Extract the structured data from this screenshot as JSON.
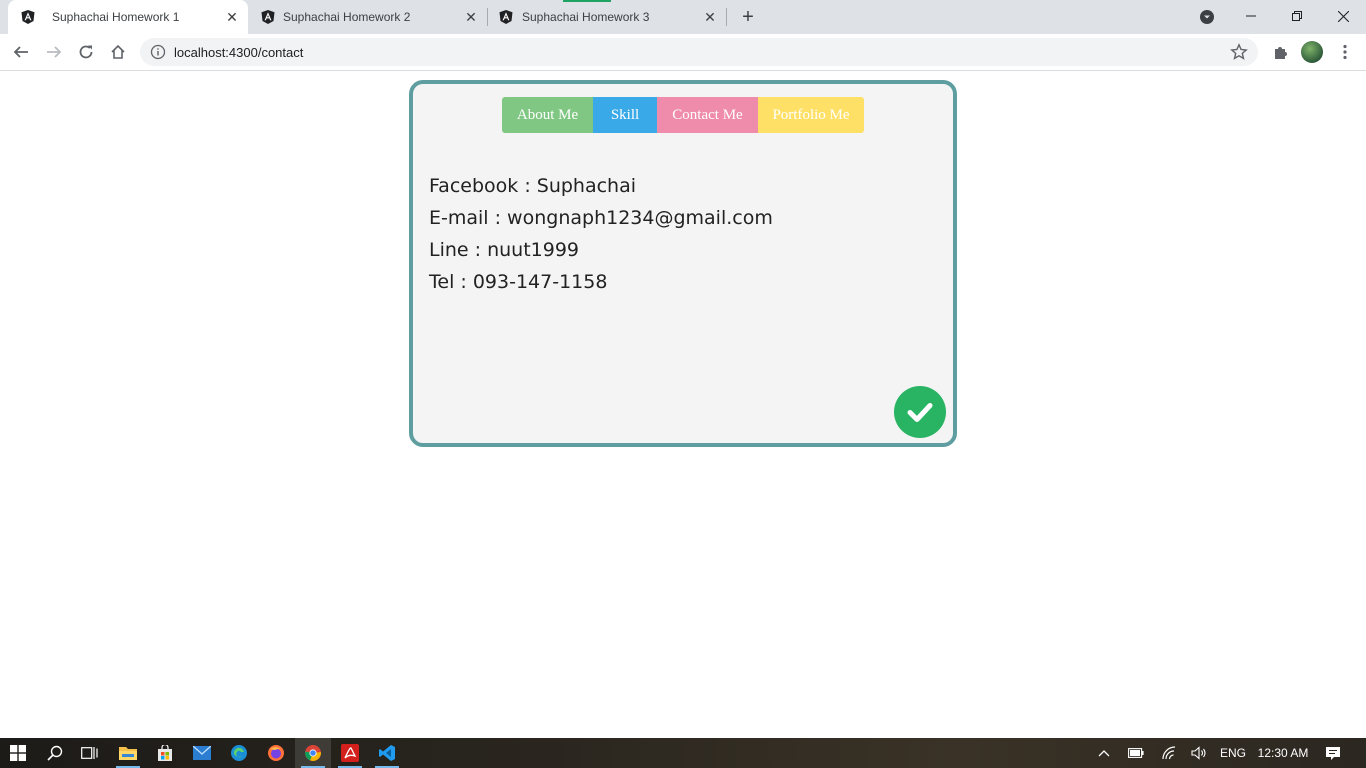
{
  "browser": {
    "tabs": [
      {
        "title": "Suphachai Homework 1",
        "active": true
      },
      {
        "title": "Suphachai Homework 2",
        "active": false
      },
      {
        "title": "Suphachai Homework 3",
        "active": false
      }
    ],
    "url": "localhost:4300/contact"
  },
  "page": {
    "nav": {
      "about": "About Me",
      "skill": "Skill",
      "contact": "Contact Me",
      "portfolio": "Portfolio Me"
    },
    "contact_lines": [
      "Facebook : Suphachai",
      "E-mail : wongnaph1234@gmail.com",
      "Line : nuut1999",
      "Tel : 093-147-1158"
    ]
  },
  "taskbar": {
    "language": "ENG",
    "time": "12:30 AM"
  },
  "colors": {
    "card_border": "#5f9ea0",
    "about": "#81c784",
    "skill": "#3aa9e8",
    "contact": "#f08cab",
    "portfolio": "#ffe066",
    "check": "#28b463"
  },
  "icons": [
    "angular-favicon",
    "close-icon",
    "plus-icon",
    "tab-search-icon",
    "minimize-icon",
    "restore-icon",
    "back-arrow-icon",
    "forward-arrow-icon",
    "reload-icon",
    "home-icon",
    "info-icon",
    "star-icon",
    "extensions-icon",
    "kebab-menu-icon",
    "check-circle-icon",
    "windows-start-icon",
    "search-icon",
    "task-view-icon",
    "file-explorer-icon",
    "store-icon",
    "mail-icon",
    "edge-icon",
    "firefox-icon",
    "chrome-icon",
    "acrobat-icon",
    "vscode-icon",
    "notification-icon"
  ]
}
